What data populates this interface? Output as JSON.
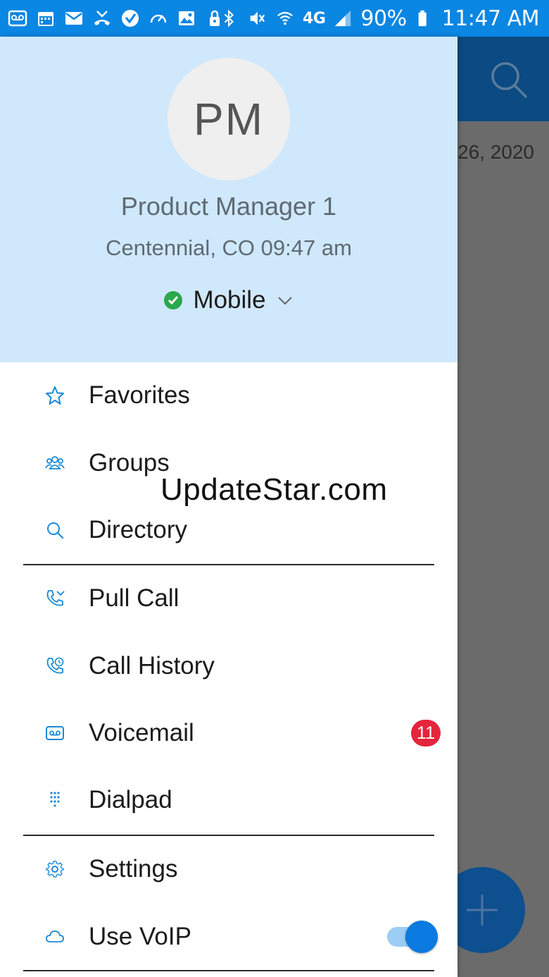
{
  "status_bar": {
    "battery_percent": "90%",
    "time": "11:47 AM",
    "network": "4G",
    "left_icons": [
      "voicemail-icon",
      "calendar-icon",
      "email-icon",
      "missed-call-icon",
      "check-app-icon",
      "speedometer-icon",
      "image-icon",
      "lock-icon"
    ],
    "right_icons": [
      "bluetooth-icon",
      "mute-icon",
      "wifi-icon",
      "signal-icon",
      "battery-icon"
    ]
  },
  "background": {
    "date_fragment": "26, 2020",
    "appbar_color": "#0b4a82",
    "fab_icon": "plus-icon"
  },
  "profile": {
    "initials": "PM",
    "name": "Product Manager 1",
    "location_time": "Centennial, CO 09:47 am",
    "status_label": "Mobile",
    "status_color": "#2aa84a"
  },
  "menu": {
    "favorites": "Favorites",
    "groups": "Groups",
    "directory": "Directory",
    "pull_call": "Pull Call",
    "call_history": "Call History",
    "voicemail": "Voicemail",
    "voicemail_badge": "11",
    "dialpad": "Dialpad",
    "settings": "Settings",
    "use_voip": "Use VoIP",
    "use_voip_enabled": true
  },
  "watermark": "UpdateStar.com",
  "colors": {
    "accent": "#0a86e3",
    "profile_bg": "#d0e8fb",
    "icon_color": "#1a8ad6",
    "badge": "#e5253c",
    "toggle": "#0a7ae0"
  }
}
